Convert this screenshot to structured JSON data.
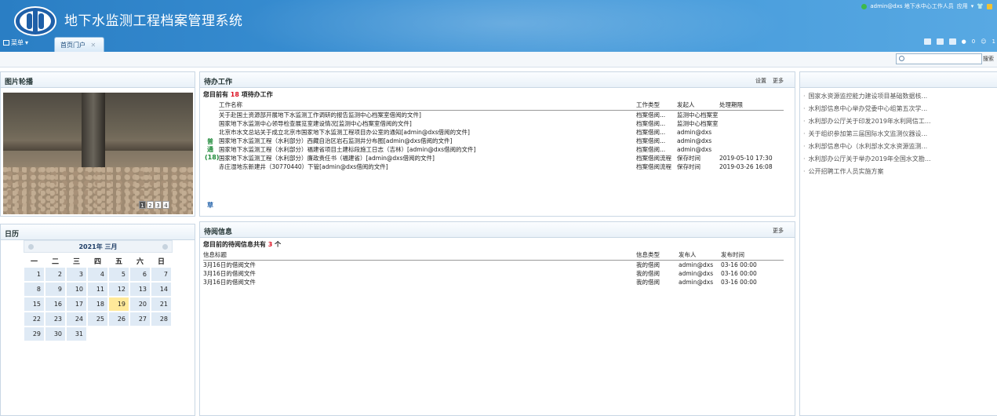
{
  "header": {
    "app_title": "地下水监测工程档案管理系统",
    "user": "admin@dxs 地下水中心工作人员",
    "apply_label": "应用",
    "menu_label": "菜单",
    "home_tab": "首页门户",
    "notify_count": "0",
    "online_count": "1"
  },
  "search": {
    "placeholder": "",
    "button": "搜索"
  },
  "slideshow": {
    "title": "图片轮播",
    "pages": [
      "1",
      "2",
      "3",
      "4"
    ]
  },
  "calendar": {
    "title": "日历",
    "month_label": "2021年 三月",
    "weekdays": [
      "一",
      "二",
      "三",
      "四",
      "五",
      "六",
      "日"
    ],
    "today": "19",
    "days": [
      "1",
      "2",
      "3",
      "4",
      "5",
      "6",
      "7",
      "8",
      "9",
      "10",
      "11",
      "12",
      "13",
      "14",
      "15",
      "16",
      "17",
      "18",
      "19",
      "20",
      "21",
      "22",
      "23",
      "24",
      "25",
      "26",
      "27",
      "28",
      "29",
      "30",
      "31"
    ]
  },
  "todo": {
    "title": "待办工作",
    "settings": "设置",
    "more": "更多",
    "summary_prefix": "您目前有",
    "count": "18",
    "summary_suffix": "项待办工作",
    "columns": [
      "工作名称",
      "工作类型",
      "发起人",
      "处理期限"
    ],
    "group_label": "普通(18)",
    "rows": [
      [
        "关于赴国土资源部开展地下水监测工作调研的报告监测中心档案室借阅的文件]",
        "档案借阅...",
        "监测中心档案室",
        ""
      ],
      [
        "国家地下水监测中心领导检查展览室建设情况[监测中心档案室借阅的文件]",
        "档案借阅...",
        "监测中心档案室",
        ""
      ],
      [
        "北京市水文总站关于成立北京市国家地下水监测工程项目办公室的通知[admin@dxs借阅的文件]",
        "档案借阅...",
        "admin@dxs",
        ""
      ],
      [
        "国家地下水监测工程（水利部分）西藏自治区岩石监测井分布图[admin@dxs借阅的文件]",
        "档案借阅...",
        "admin@dxs",
        ""
      ],
      [
        "国家地下水监测工程（水利部分）福建省项目土建标段施工日志（吉林）[admin@dxs借阅的文件]",
        "档案借阅...",
        "admin@dxs",
        ""
      ],
      [
        "国家地下水监测工程（水利部分）廉政责任书（福建省）[admin@dxs借阅的文件]",
        "档案借阅流程",
        "保存时间",
        "2019-05-10 17:30"
      ],
      [
        "赤庄湿地东新建井（30770440）下管[admin@dxs借阅的文件]",
        "档案借阅流程",
        "保存时间",
        "2019-03-26 16:08"
      ]
    ],
    "draft_label": "草"
  },
  "reading": {
    "title": "待阅信息",
    "more": "更多",
    "summary_prefix": "您目前的待阅信息共有",
    "count": "3",
    "summary_suffix": "个",
    "columns": [
      "信息标题",
      "信息类型",
      "发布人",
      "发布时间"
    ],
    "rows": [
      [
        "3月16日的借阅文件",
        "我的借阅",
        "admin@dxs",
        "03-16 00:00"
      ],
      [
        "3月16日的借阅文件",
        "我的借阅",
        "admin@dxs",
        "03-16 00:00"
      ],
      [
        "3月16日的借阅文件",
        "我的借阅",
        "admin@dxs",
        "03-16 00:00"
      ]
    ]
  },
  "news": {
    "items": [
      "国家水资源监控能力建设项目基础数据核...",
      "水利部信息中心举办党委中心组第五次学...",
      "水利部办公厅关于印发2019年水利网信工...",
      "关于组织参加第三届国际水文监测仪器设...",
      "水利部信息中心（水利部水文水资源监测...",
      "水利部办公厅关于举办2019年全国水文勘...",
      "公开招聘工作人员实施方案"
    ]
  },
  "colors": {
    "header": "#3d93d6",
    "accent_red": "#dd1122",
    "group_green": "#1f8a3a",
    "today": "#ffe99a"
  }
}
